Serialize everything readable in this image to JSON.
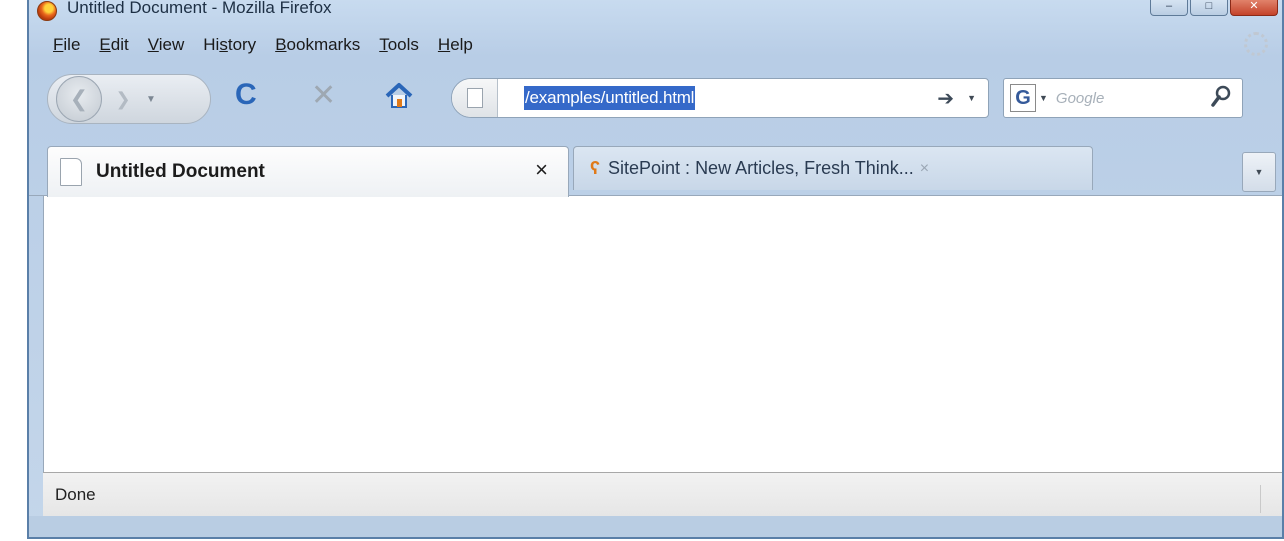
{
  "window": {
    "title": "Untitled Document - Mozilla Firefox",
    "controls": {
      "minimize": "–",
      "maximize": "□",
      "close": "✕"
    }
  },
  "menubar": {
    "items": [
      {
        "label": "File",
        "access_key": "F",
        "rest": "ile"
      },
      {
        "label": "Edit",
        "access_key": "E",
        "rest": "dit"
      },
      {
        "label": "View",
        "access_key": "V",
        "rest": "iew"
      },
      {
        "label": "History",
        "pre": "Hi",
        "access_key": "s",
        "rest": "tory"
      },
      {
        "label": "Bookmarks",
        "access_key": "B",
        "rest": "ookmarks"
      },
      {
        "label": "Tools",
        "access_key": "T",
        "rest": "ools"
      },
      {
        "label": "Help",
        "access_key": "H",
        "rest": "elp"
      }
    ]
  },
  "navbar": {
    "back_glyph": "❮",
    "forward_glyph": "❯",
    "dropdown_glyph": "▼",
    "reload_glyph": "C",
    "stop_glyph": "✕",
    "url": "/examples/untitled.html",
    "go_glyph": "➔",
    "search": {
      "engine_glyph": "G",
      "placeholder": "Google"
    }
  },
  "tabs": [
    {
      "title": "Untitled Document",
      "active": true,
      "close_glyph": "×"
    },
    {
      "title": "SitePoint : New Articles, Fresh Think...",
      "active": false,
      "close_glyph": "×",
      "icon_glyph": "ʕ"
    }
  ],
  "statusbar": {
    "text": "Done"
  },
  "icons": [
    "firefox-icon",
    "back-icon",
    "forward-icon",
    "reload-icon",
    "stop-icon",
    "home-icon",
    "page-icon",
    "go-icon",
    "google-icon",
    "search-icon",
    "document-icon",
    "sitepoint-icon",
    "close-icon",
    "throbber-icon"
  ]
}
